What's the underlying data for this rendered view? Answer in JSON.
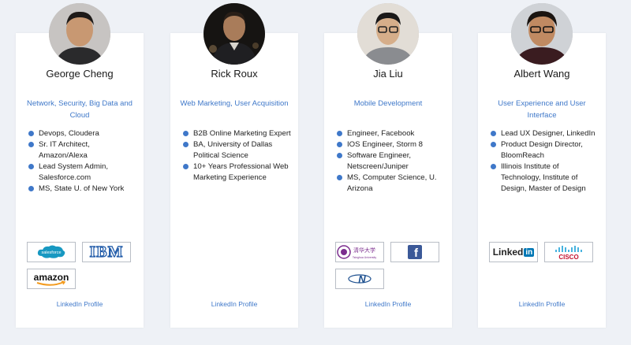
{
  "cards": [
    {
      "name": "George Cheng",
      "role": "Network, Security, Big Data and Cloud",
      "bullets": [
        "Devops, Cloudera",
        "Sr. IT Architect, Amazon/Alexa",
        "Lead System Admin, Salesforce.com",
        "MS, State U. of New York"
      ],
      "logos": [
        {
          "text": "salesforce",
          "icon": "salesforce-logo"
        },
        {
          "text": "IBM",
          "icon": "ibm-logo"
        },
        {
          "text": "amazon",
          "icon": "amazon-logo"
        }
      ],
      "link": "LinkedIn Profile"
    },
    {
      "name": "Rick Roux",
      "role": "Web Marketing, User Acquisition",
      "bullets": [
        "B2B Online Marketing Expert",
        "BA, University of Dallas Political Science",
        "10+ Years Professional Web Marketing Experience"
      ],
      "logos": [],
      "link": "LinkedIn Profile"
    },
    {
      "name": "Jia Liu",
      "role": "Mobile Development",
      "bullets": [
        "Engineer, Facebook",
        "IOS Engineer, Storm 8",
        "Software Engineer, Netscreen/Juniper",
        "MS, Computer Science, U. Arizona"
      ],
      "logos": [
        {
          "text": "清华大学",
          "subtext": "Tsinghua University",
          "icon": "tsinghua-logo"
        },
        {
          "text": "f",
          "icon": "facebook-logo"
        },
        {
          "text": "N",
          "icon": "juniper-logo"
        }
      ],
      "link": "LinkedIn Profile"
    },
    {
      "name": "Albert Wang",
      "role": "User Experience and User Interface",
      "bullets": [
        "Lead UX Designer, LinkedIn",
        "Product Design Director, BloomReach",
        "Illinois Institute of Technology, Institute of Design, Master of Design"
      ],
      "logos": [
        {
          "text": "Linked",
          "text2": "in",
          "icon": "linkedin-logo"
        },
        {
          "text": "CISCO",
          "icon": "cisco-logo"
        }
      ],
      "link": "LinkedIn Profile"
    }
  ],
  "colors": {
    "accent": "#3f78c9",
    "background": "#eef1f6",
    "card": "#ffffff"
  }
}
